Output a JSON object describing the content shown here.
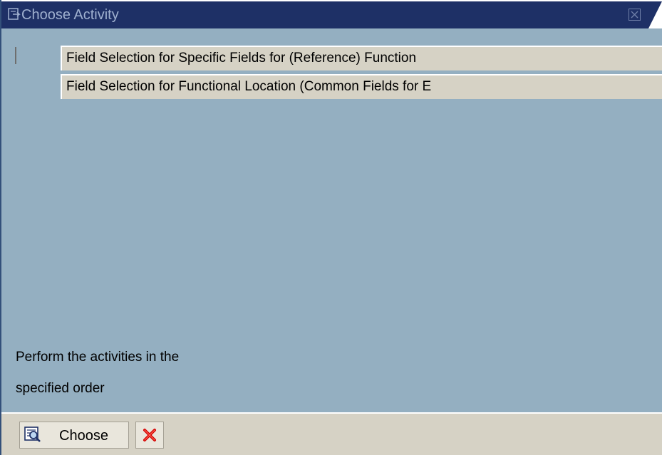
{
  "window": {
    "title": "Choose Activity"
  },
  "activities": [
    {
      "label": "Field Selection for Specific Fields for (Reference) Function"
    },
    {
      "label": "Field Selection for Functional Location (Common Fields for E"
    }
  ],
  "hint": {
    "line1": "Perform the activities in the",
    "line2": "specified order"
  },
  "footer": {
    "choose_label": "Choose",
    "choose_icon": "choose-magnifier-icon",
    "cancel_icon": "cancel-x-icon"
  },
  "colors": {
    "titlebar": "#1e3066",
    "body": "#94afc1",
    "panel": "#d6d2c5",
    "cancel_red": "#d40000"
  }
}
